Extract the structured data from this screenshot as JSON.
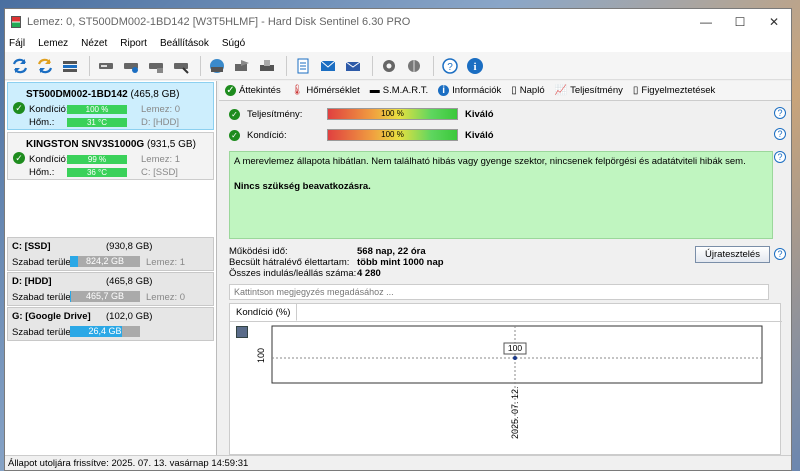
{
  "window": {
    "title": "Lemez: 0, ST500DM002-1BD142 [W3T5HLMF]  -  Hard Disk Sentinel 6.30 PRO",
    "buttons": {
      "min": "—",
      "max": "☐",
      "close": "✕"
    }
  },
  "menu": [
    "Fájl",
    "Lemez",
    "Nézet",
    "Riport",
    "Beállítások",
    "Súgó"
  ],
  "disks": [
    {
      "name": "ST500DM002-1BD142",
      "size": "(465,8 GB)",
      "health_label": "Kondíció:",
      "health": "100 %",
      "health_pct": 100,
      "temp_label": "Hőm.:",
      "temp": "31 °C",
      "aux1": "Lemez: 0",
      "aux2": "D: [HDD]"
    },
    {
      "name": "KINGSTON SNV3S1000G",
      "size": "(931,5 GB)",
      "health_label": "Kondíció:",
      "health": "99 %",
      "health_pct": 99,
      "temp_label": "Hőm.:",
      "temp": "36 °C",
      "aux1": "Lemez: 1",
      "aux2": "C: [SSD]"
    }
  ],
  "volumes": [
    {
      "name": "C: [SSD]",
      "size": "(930,8 GB)",
      "label": "Szabad terület",
      "free": "824,2 GB",
      "free_pct": 0.12,
      "disk": "Lemez: 1"
    },
    {
      "name": "D: [HDD]",
      "size": "(465,8 GB)",
      "label": "Szabad terület",
      "free": "465,7 GB",
      "free_pct": 0.02,
      "disk": "Lemez: 0"
    },
    {
      "name": "G: [Google Drive]",
      "size": "(102,0 GB)",
      "label": "Szabad terület",
      "free": "26,4 GB",
      "free_pct": 0.74,
      "disk": ""
    }
  ],
  "tabs": [
    "Áttekintés",
    "Hőmérséklet",
    "S.M.A.R.T.",
    "Információk",
    "Napló",
    "Teljesítmény",
    "Figyelmeztetések"
  ],
  "overview": {
    "performance_label": "Teljesítmény:",
    "performance_value": "100 %",
    "performance_grade": "Kiváló",
    "health_label": "Kondíció:",
    "health_value": "100 %",
    "health_grade": "Kiváló",
    "description": "A merevlemez állapota hibátlan. Nem található hibás vagy gyenge szektor, nincsenek felpörgési és adatátviteli hibák sem.",
    "advice": "Nincs szükség beavatkozásra.",
    "stats": [
      {
        "k": "Működési idő:",
        "v": "568 nap, 22 óra"
      },
      {
        "k": "Becsült hátralévő élettartam:",
        "v": "több mint 1000 nap"
      },
      {
        "k": "Összes indulás/leállás száma:",
        "v": "4 280"
      }
    ],
    "retest_button": "Újratesztelés",
    "note_placeholder": "Kattintson megjegyzés megadásához ..."
  },
  "chart_tab": "Kondíció  (%)",
  "chart_data": {
    "type": "line",
    "title": "",
    "x": [
      "2025. 07. 12."
    ],
    "series": [
      {
        "values": [
          100
        ]
      }
    ],
    "ylabel": "",
    "yticks": [
      "100"
    ],
    "data_labels": [
      "100"
    ]
  },
  "status": "Állapot utoljára frissítve: 2025. 07. 13. vasárnap 14:59:31"
}
